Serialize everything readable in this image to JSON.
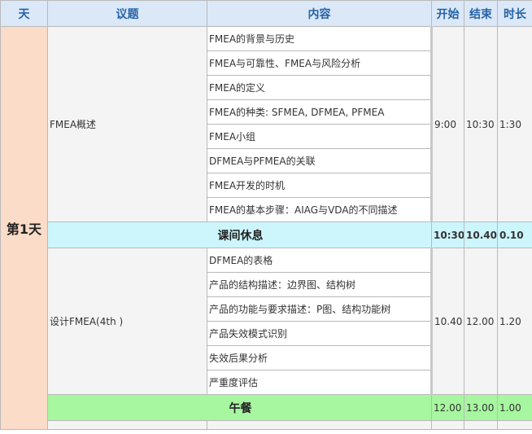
{
  "header": {
    "day": "天",
    "topic": "议题",
    "content": "内容",
    "start": "开始",
    "end": "结束",
    "duration": "时长"
  },
  "day_label": "第1天",
  "sessions": [
    {
      "topic": "FMEA概述",
      "items": [
        "FMEA的背景与历史",
        "FMEA与可靠性、FMEA与风险分析",
        "FMEA的定义",
        "FMEA的种类: SFMEA, DFMEA, PFMEA",
        "FMEA小组",
        "DFMEA与PFMEA的关联",
        "FMEA开发的时机",
        "FMEA的基本步骤：AIAG与VDA的不同描述"
      ],
      "start": "9:00",
      "end": "10:30",
      "duration": "1:30"
    },
    {
      "topic": "设计FMEA(4th )",
      "items": [
        "DFMEA的表格",
        "产品的结构描述：边界图、结构树",
        "产品的功能与要求描述：P图、结构功能树",
        "产品失效模式识别",
        "失效后果分析",
        "严重度评估"
      ],
      "start": "10.40",
      "end": "12.00",
      "duration": "1.20"
    }
  ],
  "breaks": [
    {
      "label": "课间休息",
      "start": "10:30",
      "end": "10.40",
      "duration": "0.10"
    },
    {
      "label": "午餐",
      "start": "12.00",
      "end": "13.00",
      "duration": "1.00"
    }
  ]
}
